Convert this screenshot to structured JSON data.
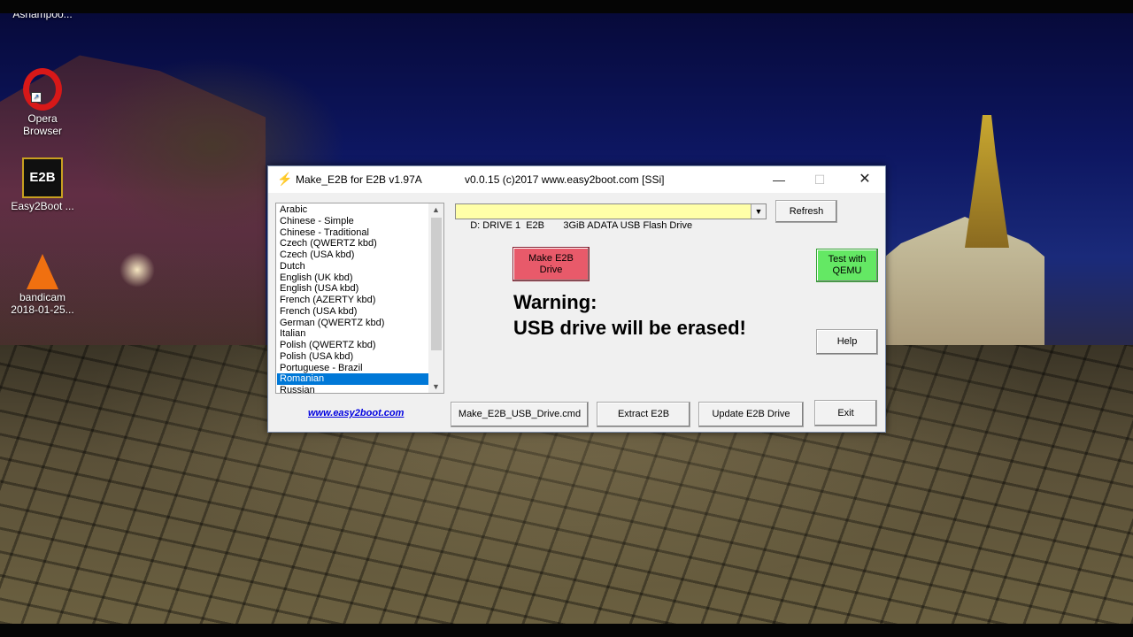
{
  "desktop": {
    "icons": [
      {
        "label": "Ashampoo...",
        "icon": "ashampoo-icon"
      },
      {
        "label": "Opera Browser",
        "icon": "opera-icon"
      },
      {
        "label": "Easy2Boot ...",
        "icon": "e2b-icon",
        "glyph": "E2B"
      },
      {
        "label": "bandicam 2018-01-25...",
        "icon": "vlc-cone-icon"
      }
    ]
  },
  "window": {
    "title": "Make_E2B for E2B v1.97A",
    "version": "v0.0.15  (c)2017 www.easy2boot.com [SSi]",
    "controls": {
      "minimize": "—",
      "maximize": "☐",
      "close": "✕"
    }
  },
  "languages": {
    "items": [
      "Arabic",
      "Chinese - Simple",
      "Chinese - Traditional",
      "Czech   (QWERTZ kbd)",
      "Czech   (USA kbd)",
      "Dutch",
      "English  (UK kbd)",
      "English  (USA kbd)",
      "French  (AZERTY kbd)",
      "French  (USA kbd)",
      "German  (QWERTZ kbd)",
      "Italian",
      "Polish  (QWERTZ kbd)",
      "Polish  (USA kbd)",
      "Portuguese - Brazil",
      "Romanian",
      "Russian"
    ],
    "selected": "Romanian"
  },
  "link": "www.easy2boot.com",
  "drive_select": {
    "value": "D: DRIVE 1  E2B       3GiB ADATA USB Flash Drive"
  },
  "buttons": {
    "refresh": "Refresh",
    "make_line1": "Make E2B",
    "make_line2": "Drive",
    "qemu_line1": "Test with",
    "qemu_line2": "QEMU",
    "help": "Help",
    "cmd": "Make_E2B_USB_Drive.cmd",
    "extract": "Extract E2B",
    "update": "Update E2B Drive",
    "exit": "Exit"
  },
  "warning": {
    "line1": "Warning:",
    "line2": "USB drive will be erased!"
  },
  "colors": {
    "combo_bg": "#ffffa8",
    "make_button": "#e85a6a",
    "qemu_button": "#64e864",
    "selection": "#0078d7"
  }
}
